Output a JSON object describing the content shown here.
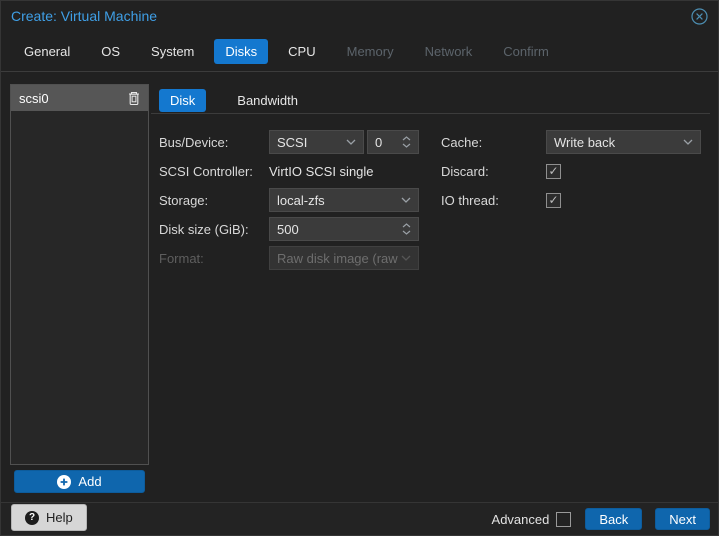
{
  "window": {
    "title": "Create: Virtual Machine"
  },
  "wizard_tabs": [
    {
      "label": "General",
      "state": "normal"
    },
    {
      "label": "OS",
      "state": "normal"
    },
    {
      "label": "System",
      "state": "normal"
    },
    {
      "label": "Disks",
      "state": "active"
    },
    {
      "label": "CPU",
      "state": "normal"
    },
    {
      "label": "Memory",
      "state": "disabled"
    },
    {
      "label": "Network",
      "state": "disabled"
    },
    {
      "label": "Confirm",
      "state": "disabled"
    }
  ],
  "disk_list": {
    "items": [
      {
        "name": "scsi0",
        "selected": true
      }
    ],
    "add_label": "Add"
  },
  "disk_tabs": [
    {
      "label": "Disk",
      "state": "active"
    },
    {
      "label": "Bandwidth",
      "state": "normal"
    }
  ],
  "form": {
    "bus_device": {
      "label": "Bus/Device:",
      "bus": "SCSI",
      "device": "0"
    },
    "scsi_controller": {
      "label": "SCSI Controller:",
      "value": "VirtIO SCSI single"
    },
    "storage": {
      "label": "Storage:",
      "value": "local-zfs"
    },
    "disk_size": {
      "label": "Disk size (GiB):",
      "value": "500"
    },
    "format": {
      "label": "Format:",
      "value": "Raw disk image (raw",
      "disabled": true
    },
    "cache": {
      "label": "Cache:",
      "value": "Write back"
    },
    "discard": {
      "label": "Discard:",
      "checked": true,
      "glyph": "✓"
    },
    "io_thread": {
      "label": "IO thread:",
      "checked": true,
      "glyph": "✓"
    }
  },
  "footer": {
    "help_label": "Help",
    "help_glyph": "?",
    "advanced_label": "Advanced",
    "advanced_checked": false,
    "back_label": "Back",
    "next_label": "Next"
  },
  "colors": {
    "title_text": "#3f9fe6",
    "active_tab": "#1478cf",
    "button_blue": "#0f66ad",
    "field_bg": "#3b3b3b",
    "selected_item_bg": "#565656",
    "dialog_bg": "#212121"
  }
}
